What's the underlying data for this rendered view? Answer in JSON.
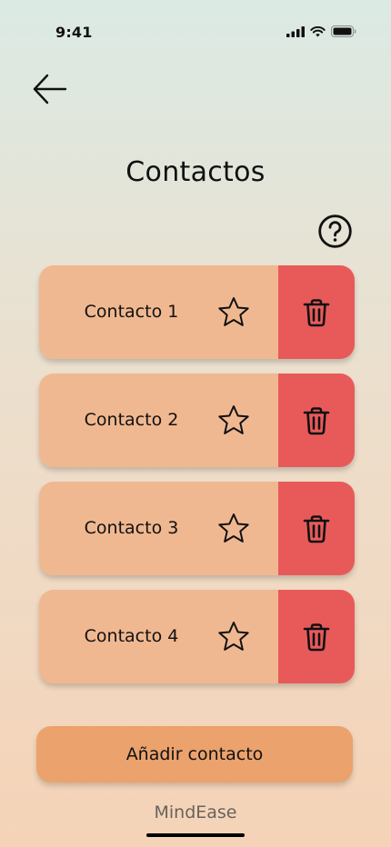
{
  "status_bar": {
    "time": "9:41",
    "icons": [
      "cellular-signal-icon",
      "wifi-icon",
      "battery-icon"
    ]
  },
  "header": {
    "back_icon": "arrow-left-icon",
    "title": "Contactos",
    "help_icon": "question-circle-icon"
  },
  "contacts": [
    {
      "name": "Contacto 1",
      "favorite": false
    },
    {
      "name": "Contacto 2",
      "favorite": false
    },
    {
      "name": "Contacto 3",
      "favorite": false
    },
    {
      "name": "Contacto 4",
      "favorite": false
    }
  ],
  "icons": {
    "favorite": "star-icon",
    "delete": "trash-icon"
  },
  "add_button": {
    "label": "Añadir contacto"
  },
  "footer": {
    "brand": "MindEase"
  },
  "colors": {
    "card": "#f0b891",
    "delete": "#e85a5a",
    "add_button": "#eba26d",
    "bg_top": "#dbeae4",
    "bg_bottom": "#f5d3b7"
  }
}
